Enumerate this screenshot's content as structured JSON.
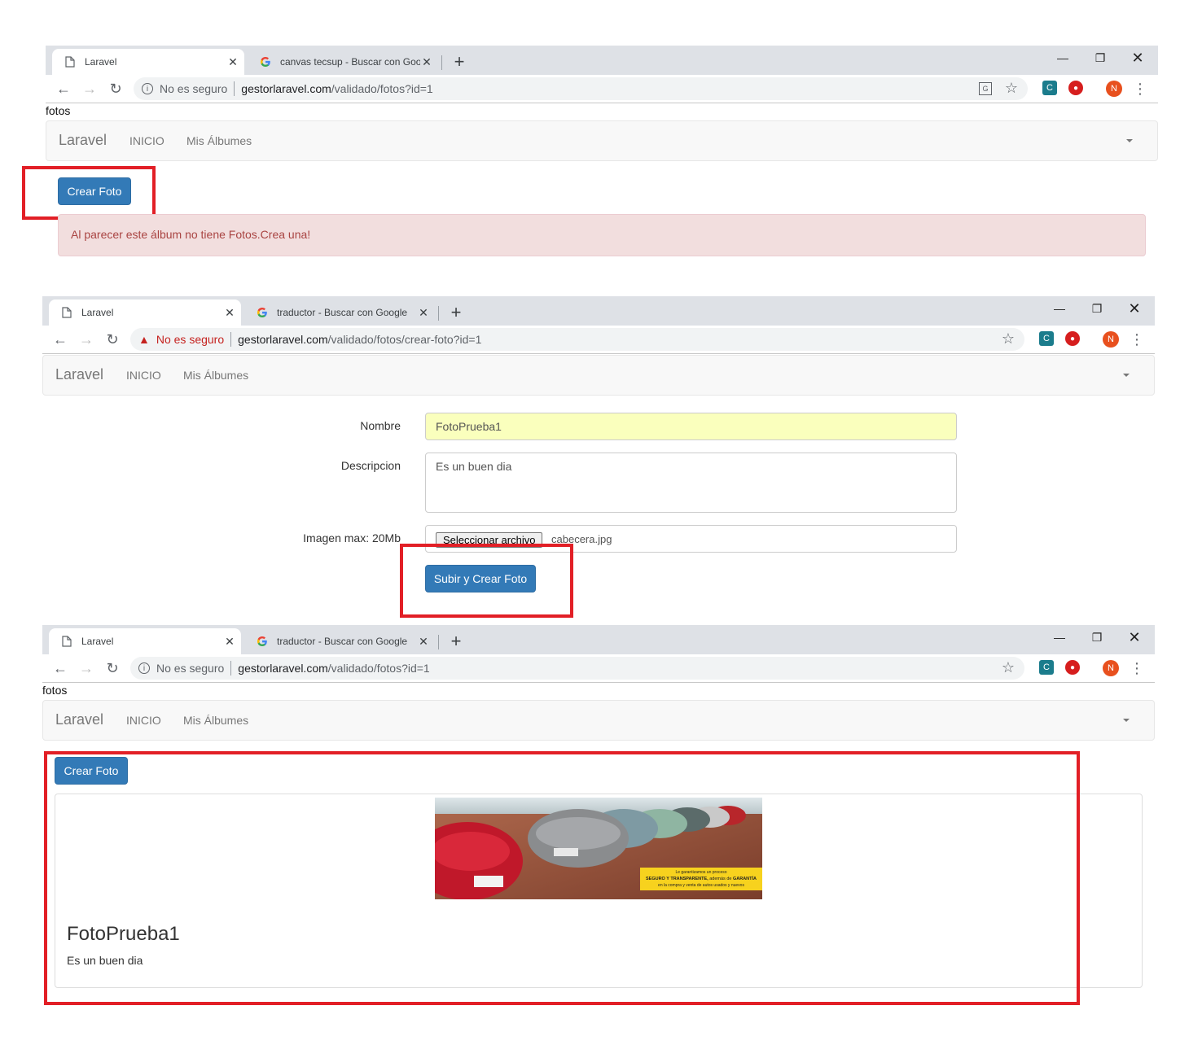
{
  "screens": [
    {
      "tabs": [
        {
          "title": "Laravel",
          "favicon": "page-icon",
          "active": true
        },
        {
          "title": "canvas tecsup - Buscar con Google",
          "favicon": "google-icon",
          "active": false
        }
      ],
      "security": "No es seguro",
      "url_domain": "gestorlaravel.com",
      "url_path": "/validado/fotos?id=1",
      "page_heading": "fotos",
      "navbar": {
        "brand": "Laravel",
        "links": [
          "INICIO",
          "Mis Álbumes"
        ]
      },
      "create_button": "Crear Foto",
      "alert": "Al parecer este álbum no tiene Fotos.Crea una!"
    },
    {
      "tabs": [
        {
          "title": "Laravel",
          "favicon": "page-icon",
          "active": true
        },
        {
          "title": "traductor - Buscar con Google",
          "favicon": "google-icon",
          "active": false
        }
      ],
      "security": "No es seguro",
      "url_domain": "gestorlaravel.com",
      "url_path": "/validado/fotos/crear-foto?id=1",
      "navbar": {
        "brand": "Laravel",
        "links": [
          "INICIO",
          "Mis Álbumes"
        ]
      },
      "form": {
        "name_label": "Nombre",
        "name_value": "FotoPrueba1",
        "desc_label": "Descripcion",
        "desc_value": "Es un buen dia",
        "image_label": "Imagen max: 20Mb",
        "file_button": "Seleccionar archivo",
        "file_name": "cabecera.jpg",
        "submit": "Subir y Crear Foto"
      }
    },
    {
      "tabs": [
        {
          "title": "Laravel",
          "favicon": "page-icon",
          "active": true
        },
        {
          "title": "traductor - Buscar con Google",
          "favicon": "google-icon",
          "active": false
        }
      ],
      "security": "No es seguro",
      "url_domain": "gestorlaravel.com",
      "url_path": "/validado/fotos?id=1",
      "page_heading": "fotos",
      "navbar": {
        "brand": "Laravel",
        "links": [
          "INICIO",
          "Mis Álbumes"
        ]
      },
      "create_button": "Crear Foto",
      "photo": {
        "title": "FotoPrueba1",
        "description": "Es un buen dia",
        "banner_line1": "Le garantizamos un proceso",
        "banner_line2a": "SEGURO Y TRANSPARENTE,",
        "banner_line2b": " además de ",
        "banner_line2c": "GARANTÍA",
        "banner_line3": "en la compra y venta de autos usados y nuevos"
      }
    }
  ],
  "toolbar": {
    "avatar_initial": "N"
  },
  "colors": {
    "primary": "#337ab7",
    "alert_bg": "#f2dede",
    "alert_text": "#a94442",
    "highlight_box": "#e21f26",
    "autofill": "#faffbd"
  }
}
